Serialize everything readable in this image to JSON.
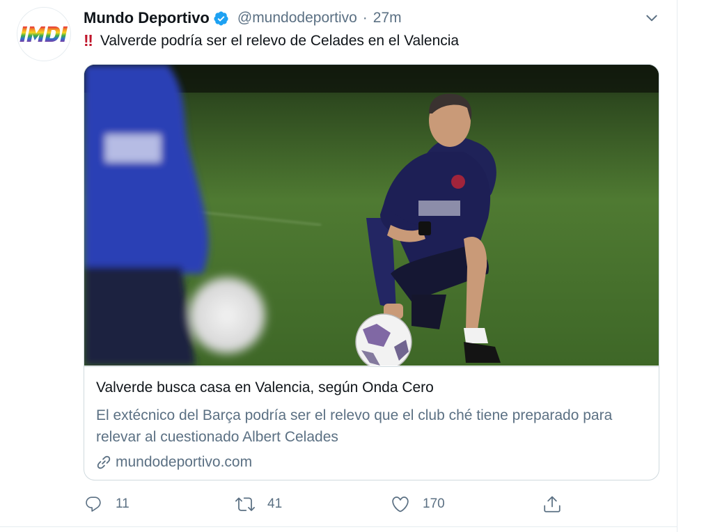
{
  "tweet": {
    "author_name": "Mundo Deportivo",
    "handle": "@mundodeportivo",
    "separator": "·",
    "time": "27m",
    "text_emoji": "‼",
    "text": "Valverde podría ser el relevo de Celades en el Valencia",
    "avatar_logo_text": "MD",
    "icons": {
      "avatar": "mundo-deportivo-rainbow-logo",
      "verified": "verified-badge-icon",
      "caret": "chevron-down-icon"
    }
  },
  "card": {
    "image_alt": "Ernesto Valverde kneeling on a training pitch with his hand on a football",
    "title": "Valverde busca casa en Valencia, según Onda Cero",
    "description": "El extécnico del Barça podría ser el relevo que el club ché tiene preparado para relevar al cuestionado Albert Celades",
    "domain": "mundodeportivo.com",
    "link_icon": "link-icon"
  },
  "actions": {
    "reply_count": "11",
    "retweet_count": "41",
    "like_count": "170",
    "icons": [
      "reply-icon",
      "retweet-icon",
      "like-icon",
      "share-icon"
    ]
  },
  "colors": {
    "text_primary": "#0f1419",
    "text_secondary": "#5b7083",
    "border": "#cfd9de",
    "verified_blue": "#1da1f2",
    "double_exclamation_red": "#c0162b"
  }
}
